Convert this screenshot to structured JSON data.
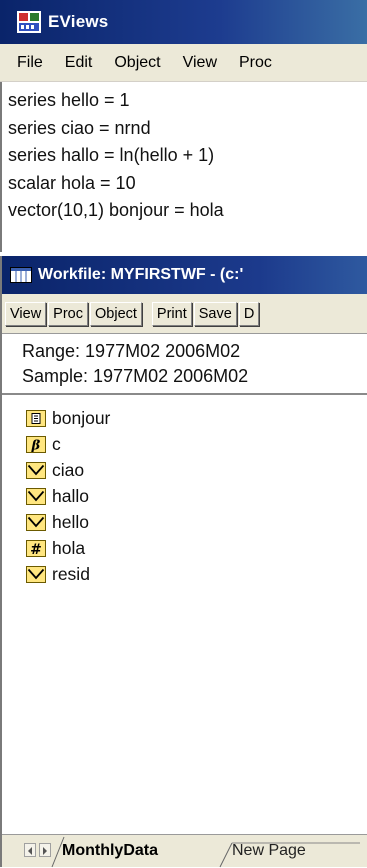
{
  "app": {
    "title": "EViews"
  },
  "menu": [
    "File",
    "Edit",
    "Object",
    "View",
    "Proc"
  ],
  "command_lines": [
    "series hello = 1",
    "series ciao = nrnd",
    "series hallo = ln(hello + 1)",
    "scalar hola = 10",
    "vector(10,1) bonjour = hola"
  ],
  "workfile": {
    "title": "Workfile: MYFIRSTWF - (c:'",
    "toolbar": [
      "View",
      "Proc",
      "Object",
      "Print",
      "Save",
      "D"
    ],
    "range_line": "Range:   1977M02 2006M02",
    "sample_line": "Sample: 1977M02 2006M02",
    "objects": [
      {
        "name": "bonjour",
        "icon": "vector-icon"
      },
      {
        "name": "c",
        "icon": "coefficient-icon"
      },
      {
        "name": "ciao",
        "icon": "series-icon"
      },
      {
        "name": "hallo",
        "icon": "series-icon"
      },
      {
        "name": "hello",
        "icon": "series-icon"
      },
      {
        "name": "hola",
        "icon": "scalar-icon"
      },
      {
        "name": "resid",
        "icon": "series-icon"
      }
    ],
    "tabs": {
      "active": "MonthlyData",
      "inactive": "New Page"
    }
  }
}
